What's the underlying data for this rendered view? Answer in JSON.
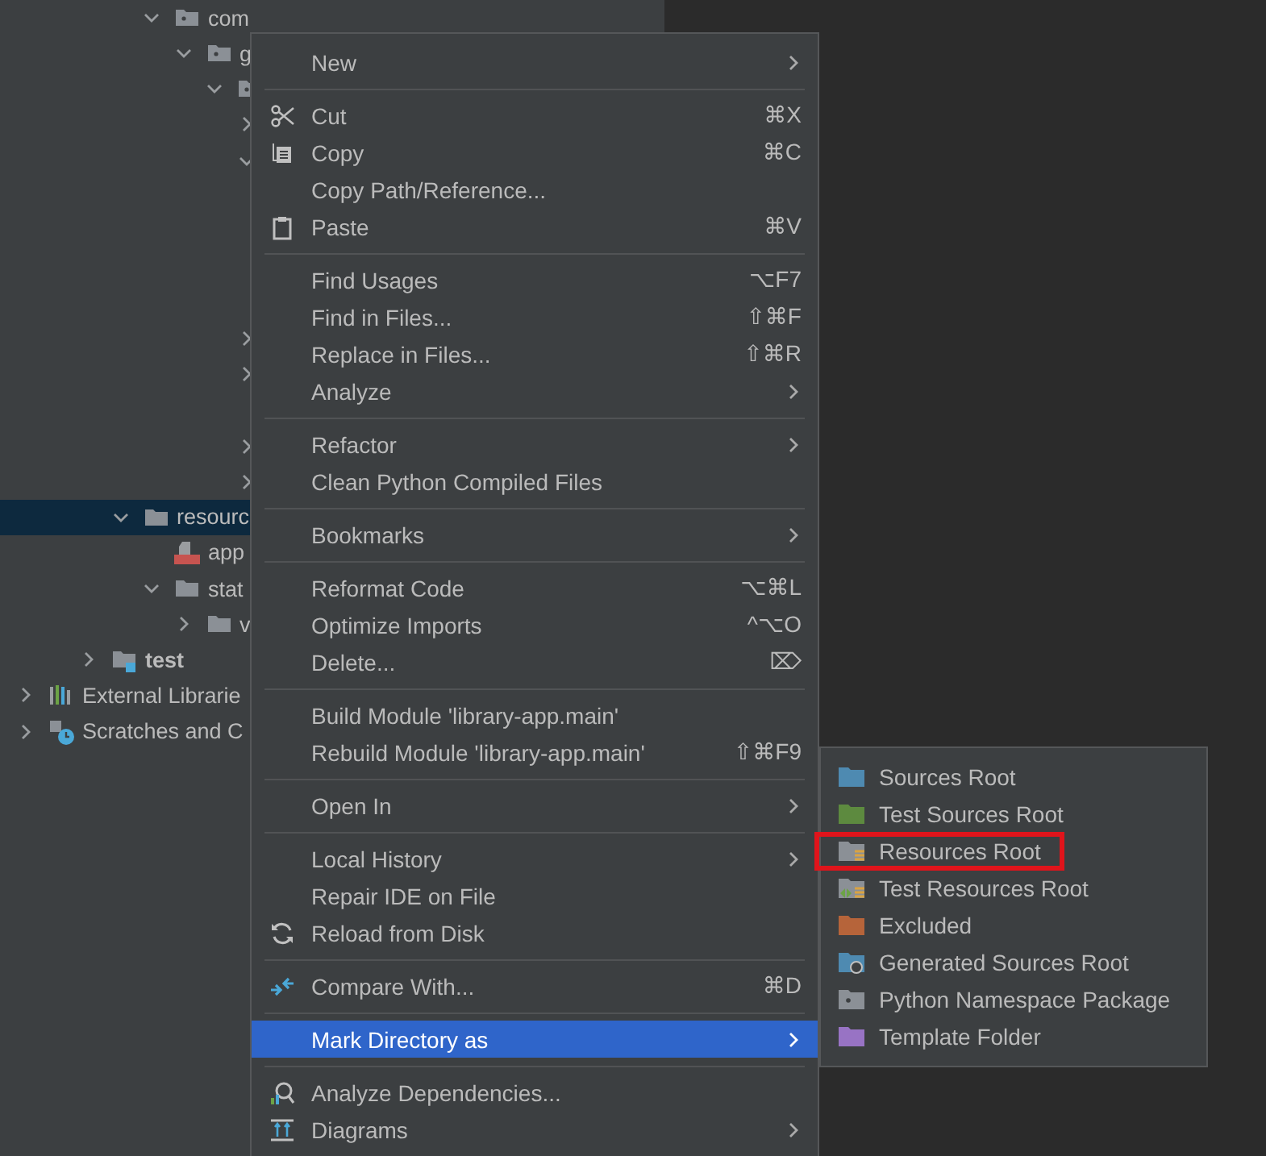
{
  "tree": [
    {
      "kind": "offscreen",
      "children": [
        {
          "kind": "offscreen",
          "children": [
            {
              "kind": "offscreen",
              "children": [
                {
                  "kind": "offscreen",
                  "children": [
                    {
                      "label": "com",
                      "kind": "package",
                      "expanded": true,
                      "selected": false,
                      "children": [
                        {
                          "label": "g",
                          "kind": "package",
                          "expanded": true,
                          "selected": false,
                          "children": [
                            {
                              "kind": "package",
                              "expanded": true,
                              "selected": false,
                              "children": [
                                {
                                  "kind": "row",
                                  "expanded": false,
                                  "selected": false
                                },
                                {
                                  "kind": "row",
                                  "expanded": true,
                                  "selected": false,
                                  "children": [
                                    {
                                      "kind": "covered"
                                    },
                                    {
                                      "kind": "covered"
                                    },
                                    {
                                      "kind": "covered"
                                    },
                                    {
                                      "kind": "covered"
                                    }
                                  ]
                                },
                                {
                                  "kind": "row",
                                  "expanded": false,
                                  "selected": false
                                },
                                {
                                  "kind": "row",
                                  "expanded": false,
                                  "selected": false
                                },
                                {
                                  "kind": "covered"
                                },
                                {
                                  "kind": "row",
                                  "expanded": false,
                                  "selected": false
                                },
                                {
                                  "kind": "row",
                                  "expanded": false,
                                  "selected": false
                                }
                              ]
                            }
                          ]
                        }
                      ]
                    }
                  ]
                },
                {
                  "label": "resourc",
                  "kind": "folder",
                  "expanded": true,
                  "selected": true,
                  "children": [
                    {
                      "label": "app",
                      "kind": "yml",
                      "selected": false
                    },
                    {
                      "label": "stat",
                      "kind": "folder",
                      "expanded": true,
                      "selected": false,
                      "children": [
                        {
                          "label": "v",
                          "kind": "folder",
                          "expanded": false,
                          "selected": false
                        }
                      ]
                    }
                  ]
                }
              ]
            },
            {
              "label": "test",
              "kind": "test-folder",
              "bold": true,
              "expanded": false,
              "selected": false
            }
          ]
        }
      ]
    },
    {
      "label": "External Librarie",
      "kind": "libraries",
      "expanded": false,
      "selected": false
    },
    {
      "label": "Scratches and C",
      "kind": "scratches",
      "expanded": false,
      "selected": false
    }
  ],
  "menu": [
    [
      {
        "label": "New",
        "submenu": true,
        "selected": false
      }
    ],
    [
      {
        "label": "Cut",
        "kind": "scissors",
        "shortcut": "⌘X",
        "selected": false
      },
      {
        "label": "Copy",
        "kind": "copy",
        "shortcut": "⌘C",
        "selected": false
      },
      {
        "label": "Copy Path/Reference...",
        "selected": false
      },
      {
        "label": "Paste",
        "kind": "clipboard",
        "shortcut": "⌘V",
        "selected": false
      }
    ],
    [
      {
        "label": "Find Usages",
        "shortcut": "⌥F7",
        "selected": false
      },
      {
        "label": "Find in Files...",
        "shortcut": "⇧⌘F",
        "selected": false
      },
      {
        "label": "Replace in Files...",
        "shortcut": "⇧⌘R",
        "selected": false
      },
      {
        "label": "Analyze",
        "submenu": true,
        "selected": false
      }
    ],
    [
      {
        "label": "Refactor",
        "submenu": true,
        "selected": false
      },
      {
        "label": "Clean Python Compiled Files",
        "selected": false
      }
    ],
    [
      {
        "label": "Bookmarks",
        "submenu": true,
        "selected": false
      }
    ],
    [
      {
        "label": "Reformat Code",
        "shortcut": "⌥⌘L",
        "selected": false
      },
      {
        "label": "Optimize Imports",
        "shortcut": "^⌥O",
        "selected": false
      },
      {
        "label": "Delete...",
        "shortcut": "⌦",
        "selected": false
      }
    ],
    [
      {
        "label": "Build Module 'library-app.main'",
        "selected": false
      },
      {
        "label": "Rebuild Module 'library-app.main'",
        "shortcut": "⇧⌘F9",
        "selected": false
      }
    ],
    [
      {
        "label": "Open In",
        "submenu": true,
        "selected": false
      }
    ],
    [
      {
        "label": "Local History",
        "submenu": true,
        "selected": false
      },
      {
        "label": "Repair IDE on File",
        "selected": false
      },
      {
        "label": "Reload from Disk",
        "kind": "reload",
        "selected": false
      }
    ],
    [
      {
        "label": "Compare With...",
        "kind": "compare",
        "shortcut": "⌘D",
        "selected": false
      }
    ],
    [
      {
        "label": "Mark Directory as",
        "submenu": true,
        "selected": true
      }
    ],
    [
      {
        "label": "Analyze Dependencies...",
        "kind": "dependencies",
        "selected": false
      },
      {
        "label": "Diagrams",
        "kind": "diagrams",
        "submenu": true,
        "selected": false
      }
    ]
  ],
  "submenu": [
    {
      "label": "Sources Root",
      "kind": "sources",
      "highlighted": false
    },
    {
      "label": "Test Sources Root",
      "kind": "test-sources",
      "highlighted": false
    },
    {
      "label": "Resources Root",
      "kind": "resources",
      "highlighted": true
    },
    {
      "label": "Test Resources Root",
      "kind": "test-resources",
      "highlighted": false
    },
    {
      "label": "Excluded",
      "kind": "excluded",
      "highlighted": false
    },
    {
      "label": "Generated Sources Root",
      "kind": "generated",
      "highlighted": false
    },
    {
      "label": "Python Namespace Package",
      "kind": "namespace",
      "highlighted": false
    },
    {
      "label": "Template Folder",
      "kind": "template",
      "highlighted": false
    }
  ]
}
